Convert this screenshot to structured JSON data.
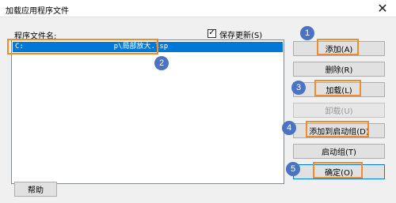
{
  "window": {
    "title": "加载应用程序文件",
    "close_glyph": "✕"
  },
  "file_list": {
    "label": "程序文件名:",
    "entries": [
      {
        "path": "C:                     p\\局部放大.lsp",
        "selected": true
      }
    ]
  },
  "save_option": {
    "label": "保存更新(S)",
    "checked": true
  },
  "buttons": {
    "add": "添加(A)",
    "remove": "删除(R)",
    "load": "加载(L)",
    "unload": "卸载(U)",
    "add_to_startup": "添加到启动组(D)",
    "startup_suite": "启动组(T)",
    "ok": "确定(O)",
    "help": "帮助"
  },
  "annotations": {
    "markers": [
      "1",
      "2",
      "3",
      "4",
      "5"
    ],
    "marker_color": "#4a73c4",
    "highlight_color": "#f28c28"
  },
  "colors": {
    "selection": "#0078d7",
    "default_button_border": "#0078d7"
  }
}
